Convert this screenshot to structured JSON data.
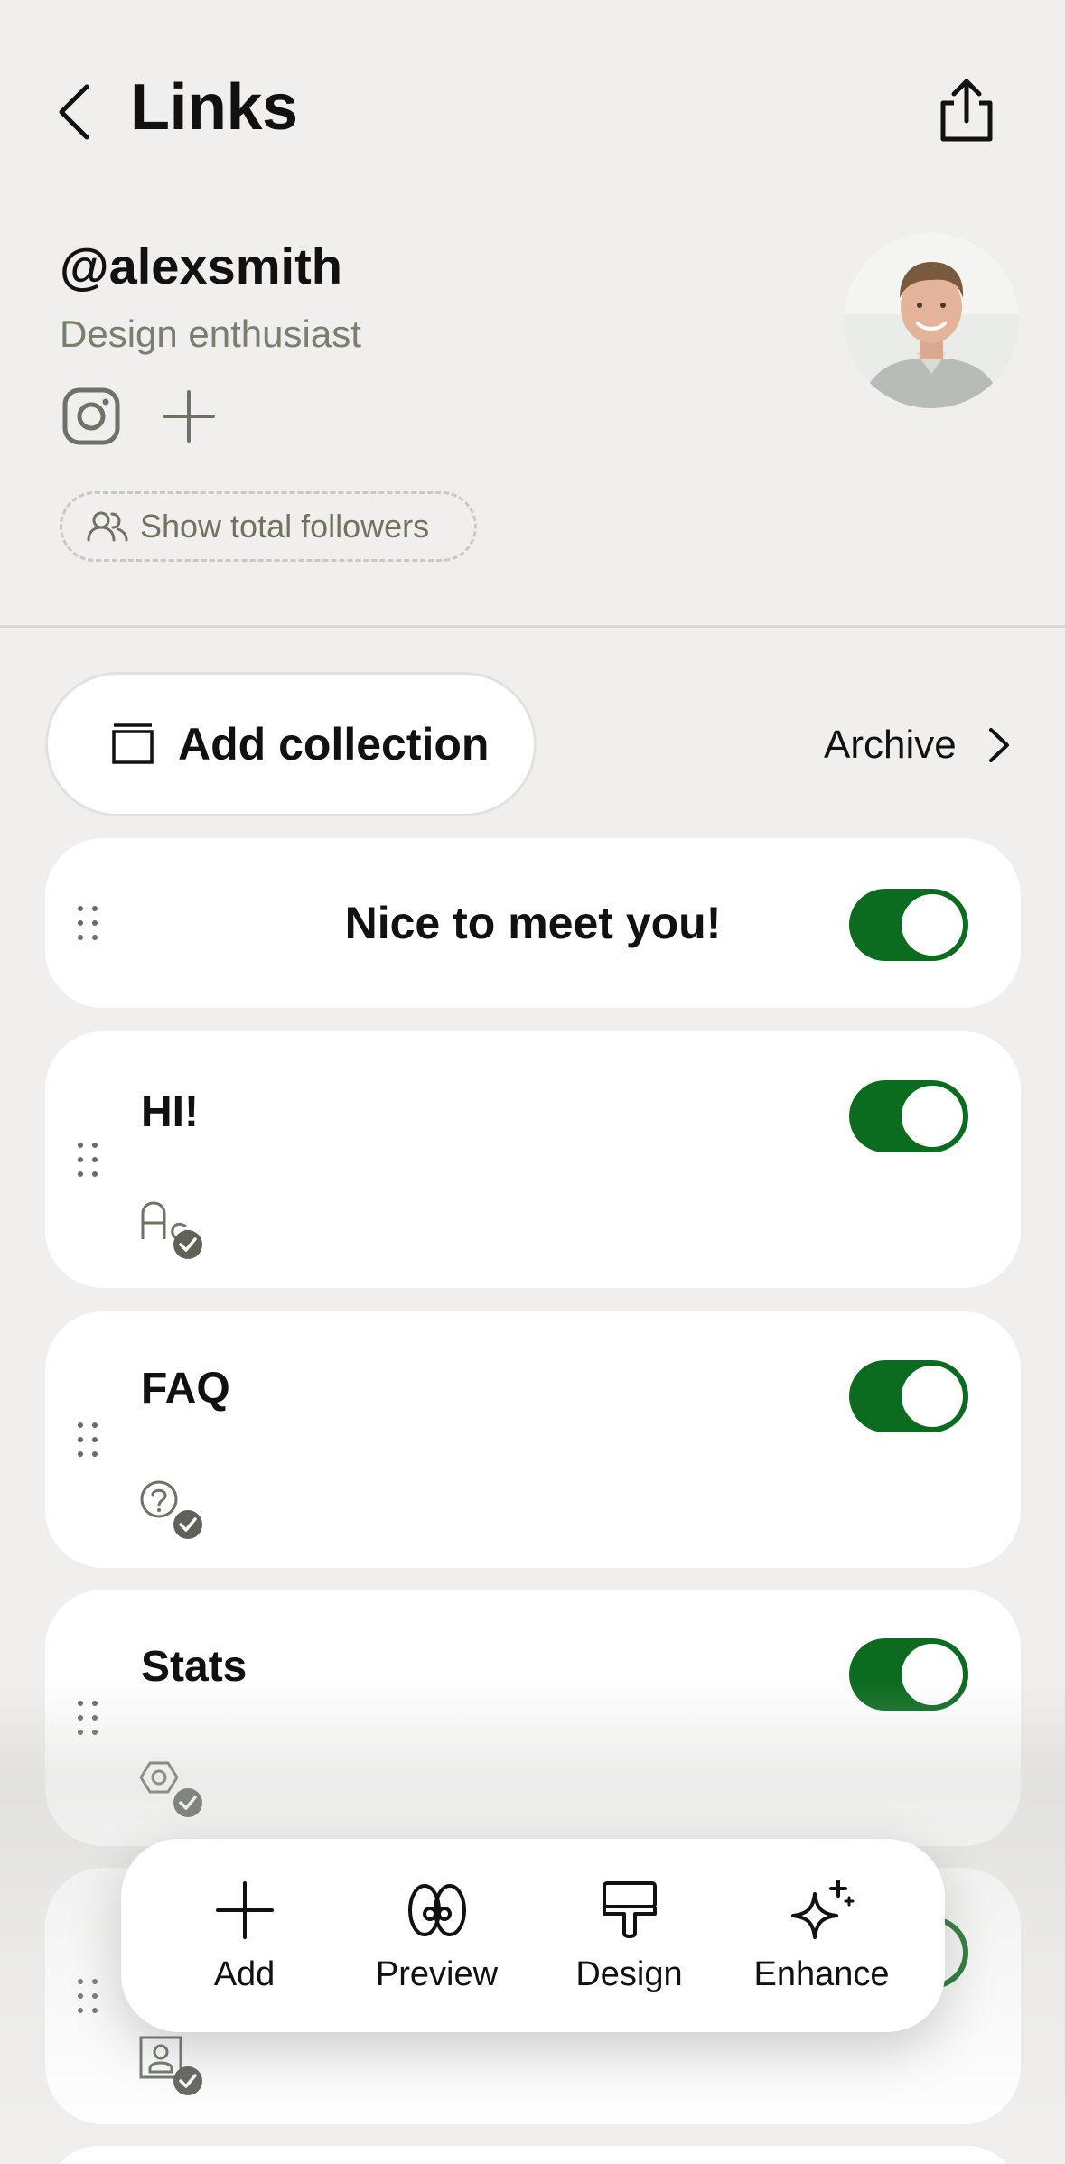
{
  "header": {
    "title": "Links",
    "back_icon": "chevron-left-icon",
    "share_icon": "share-icon"
  },
  "profile": {
    "username": "@alexsmith",
    "bio": "Design enthusiast",
    "social_icons": [
      "instagram-icon",
      "plus-icon"
    ],
    "followers_label": "Show total followers"
  },
  "collections": {
    "add_label": "Add collection",
    "archive_label": "Archive"
  },
  "cards": [
    {
      "title": "Nice to meet you!",
      "enabled": true
    },
    {
      "title": "HI!",
      "enabled": true,
      "icon": "font-icon"
    },
    {
      "title": "FAQ",
      "enabled": true,
      "icon": "question-icon"
    },
    {
      "title": "Stats",
      "enabled": true,
      "icon": "hexagon-icon"
    },
    {
      "title": "",
      "enabled": true,
      "icon": "contact-card-icon"
    }
  ],
  "toolbar": {
    "add": "Add",
    "preview": "Preview",
    "design": "Design",
    "enhance": "Enhance"
  },
  "colors": {
    "background": "#f0efed",
    "toggle_on": "#0b6b1f",
    "muted_text": "#7a7e6e",
    "badge": "#5e6259"
  }
}
